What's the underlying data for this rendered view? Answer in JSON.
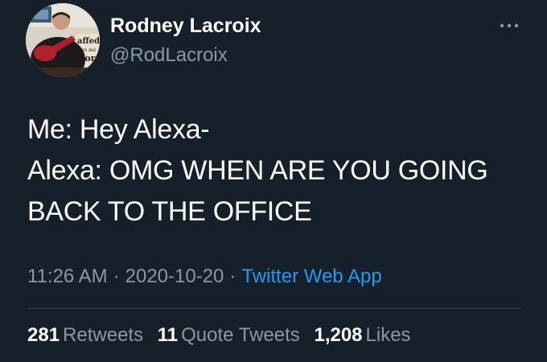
{
  "tweet": {
    "author": {
      "display_name": "Rodney Lacroix",
      "handle": "@RodLacroix"
    },
    "text_lines": [
      "Me: Hey Alexa-",
      "Alexa: OMG WHEN ARE YOU GOING",
      "BACK TO THE OFFICE"
    ],
    "time": "11:26 AM",
    "date": "2020-10-20",
    "separator": "·",
    "source": "Twitter Web App",
    "stats": {
      "retweets": {
        "count": "281",
        "label": "Retweets"
      },
      "quote_tweets": {
        "count": "11",
        "label": "Quote Tweets"
      },
      "likes": {
        "count": "1,208",
        "label": "Likes"
      }
    }
  },
  "colors": {
    "background": "#15202b",
    "primary_text": "#ffffff",
    "secondary_text": "#8b98a5",
    "link": "#1d9bf0",
    "divider": "#38444d"
  },
  "icons": {
    "more": "more-horizontal-icon"
  }
}
